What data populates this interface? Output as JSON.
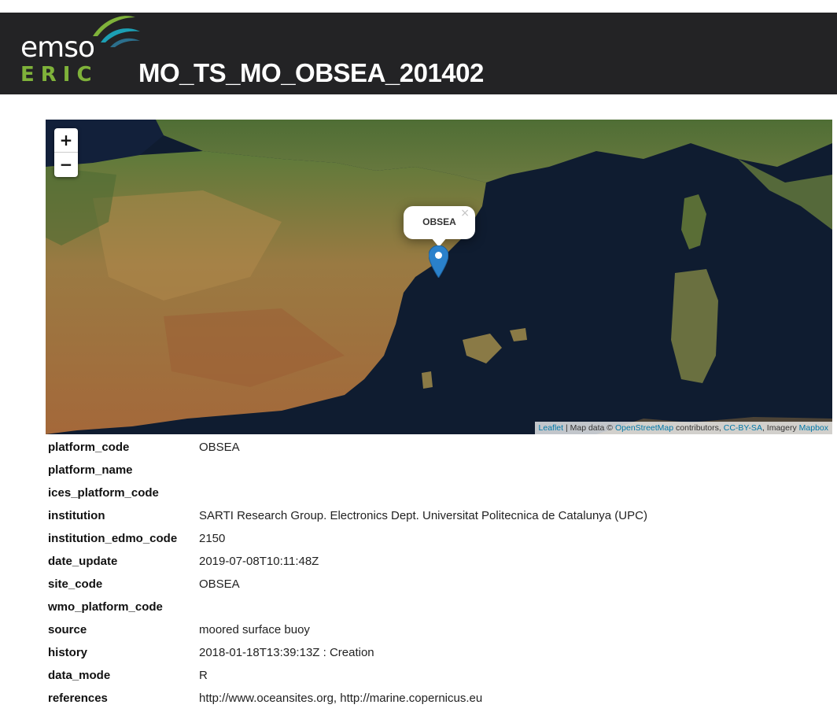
{
  "header": {
    "logo_top": "emso",
    "logo_bottom": "ERIC",
    "title": "MO_TS_MO_OBSEA_201402"
  },
  "map": {
    "zoom_in": "+",
    "zoom_out": "−",
    "popup_label": "OBSEA",
    "popup_close": "×",
    "attribution": {
      "leaflet": "Leaflet",
      "sep1": " | Map data © ",
      "osm": "OpenStreetMap",
      "sep2": " contributors, ",
      "license": "CC-BY-SA",
      "sep3": ", Imagery ",
      "mapbox": "Mapbox"
    }
  },
  "metadata": [
    {
      "key": "platform_code",
      "value": "OBSEA"
    },
    {
      "key": "platform_name",
      "value": ""
    },
    {
      "key": "ices_platform_code",
      "value": ""
    },
    {
      "key": "institution",
      "value": "SARTI Research Group. Electronics Dept. Universitat Politecnica de Catalunya (UPC)"
    },
    {
      "key": "institution_edmo_code",
      "value": "2150"
    },
    {
      "key": "date_update",
      "value": "2019-07-08T10:11:48Z"
    },
    {
      "key": "site_code",
      "value": "OBSEA"
    },
    {
      "key": "wmo_platform_code",
      "value": ""
    },
    {
      "key": "source",
      "value": "moored surface buoy"
    },
    {
      "key": "history",
      "value": "2018-01-18T13:39:13Z : Creation"
    },
    {
      "key": "data_mode",
      "value": "R"
    },
    {
      "key": "references",
      "value": "http://www.oceansites.org, http://marine.copernicus.eu"
    }
  ],
  "colors": {
    "header_bg": "#232325",
    "logo_green": "#7fb23a",
    "marker_blue": "#2a81cb",
    "link": "#0078a8"
  }
}
